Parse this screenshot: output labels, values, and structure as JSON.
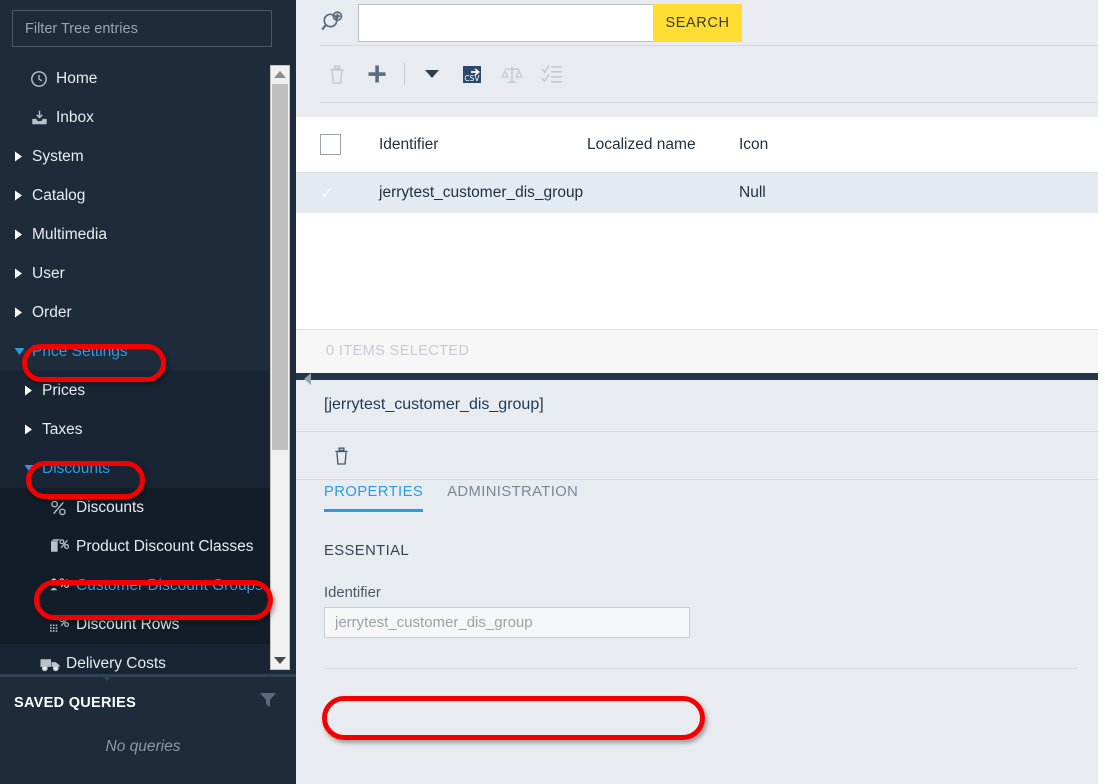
{
  "sidebar": {
    "filter_placeholder": "Filter Tree entries",
    "tree": [
      {
        "label": "Home",
        "level": 1,
        "icon": "home-clock-icon",
        "twisty": "none",
        "selected": false
      },
      {
        "label": "Inbox",
        "level": 1,
        "icon": "inbox-icon",
        "twisty": "none",
        "selected": false
      },
      {
        "label": "System",
        "level": 1,
        "icon": "none",
        "twisty": "collapsed",
        "selected": false
      },
      {
        "label": "Catalog",
        "level": 1,
        "icon": "none",
        "twisty": "collapsed",
        "selected": false
      },
      {
        "label": "Multimedia",
        "level": 1,
        "icon": "none",
        "twisty": "collapsed",
        "selected": false
      },
      {
        "label": "User",
        "level": 1,
        "icon": "none",
        "twisty": "collapsed",
        "selected": false
      },
      {
        "label": "Order",
        "level": 1,
        "icon": "none",
        "twisty": "collapsed",
        "selected": false
      },
      {
        "label": "Price Settings",
        "level": 1,
        "icon": "none",
        "twisty": "expanded",
        "selected": true
      },
      {
        "label": "Prices",
        "level": 2,
        "icon": "none",
        "twisty": "collapsed",
        "selected": false
      },
      {
        "label": "Taxes",
        "level": 2,
        "icon": "none",
        "twisty": "collapsed",
        "selected": false
      },
      {
        "label": "Discounts",
        "level": 2,
        "icon": "none",
        "twisty": "expanded",
        "selected": true
      },
      {
        "label": "Discounts",
        "level": 3,
        "icon": "percent-icon",
        "twisty": "none",
        "selected": false
      },
      {
        "label": "Product Discount Classes",
        "level": 3,
        "icon": "product-percent-icon",
        "twisty": "none",
        "selected": false
      },
      {
        "label": "Customer Discount Groups",
        "level": 3,
        "icon": "customer-percent-icon",
        "twisty": "none",
        "selected": true
      },
      {
        "label": "Discount Rows",
        "level": 3,
        "icon": "rows-percent-icon",
        "twisty": "none",
        "selected": false
      },
      {
        "label": "Delivery Costs",
        "level": 2,
        "icon": "truck-icon",
        "twisty": "none",
        "selected": false
      }
    ],
    "saved_queries": {
      "title": "SAVED QUERIES",
      "empty_text": "No queries",
      "filter_icon": "funnel-icon"
    }
  },
  "search": {
    "advanced_icon": "magnifier-plus-icon",
    "value": "",
    "placeholder": "",
    "button_label": "SEARCH"
  },
  "toolbar": {
    "buttons": [
      {
        "name": "delete-button",
        "icon": "trash-icon",
        "state": "disabled"
      },
      {
        "name": "create-button",
        "icon": "plus-icon",
        "state": "enabled"
      },
      {
        "name": "create-menu-button",
        "icon": "caret-down-icon",
        "state": "enabled"
      },
      {
        "name": "export-csv-button",
        "icon": "csv-export-icon",
        "state": "enabled"
      },
      {
        "name": "compare-button",
        "icon": "scales-icon",
        "state": "disabled"
      },
      {
        "name": "checklist-button",
        "icon": "checklist-icon",
        "state": "disabled"
      }
    ]
  },
  "grid": {
    "columns": [
      "Identifier",
      "Localized name",
      "Icon"
    ],
    "rows": [
      {
        "identifier": "jerrytest_customer_dis_group",
        "localized_name": "",
        "icon": "Null",
        "checked": true
      }
    ],
    "status": "0 ITEMS SELECTED"
  },
  "detail": {
    "title": "[jerrytest_customer_dis_group]",
    "delete_icon": "trash-icon",
    "tabs": [
      {
        "label": "PROPERTIES",
        "active": true
      },
      {
        "label": "ADMINISTRATION",
        "active": false
      }
    ],
    "section": "ESSENTIAL",
    "identifier_label": "Identifier",
    "identifier_value": "jerrytest_customer_dis_group"
  },
  "colors": {
    "sidebar_bg": "#1d2b3a",
    "accent_blue": "#2e9ae0",
    "search_yellow": "#ffdd33",
    "panel_bg": "#e8ecf0",
    "row_selected": "#e3eaf1",
    "annotation_red": "#f50000"
  }
}
